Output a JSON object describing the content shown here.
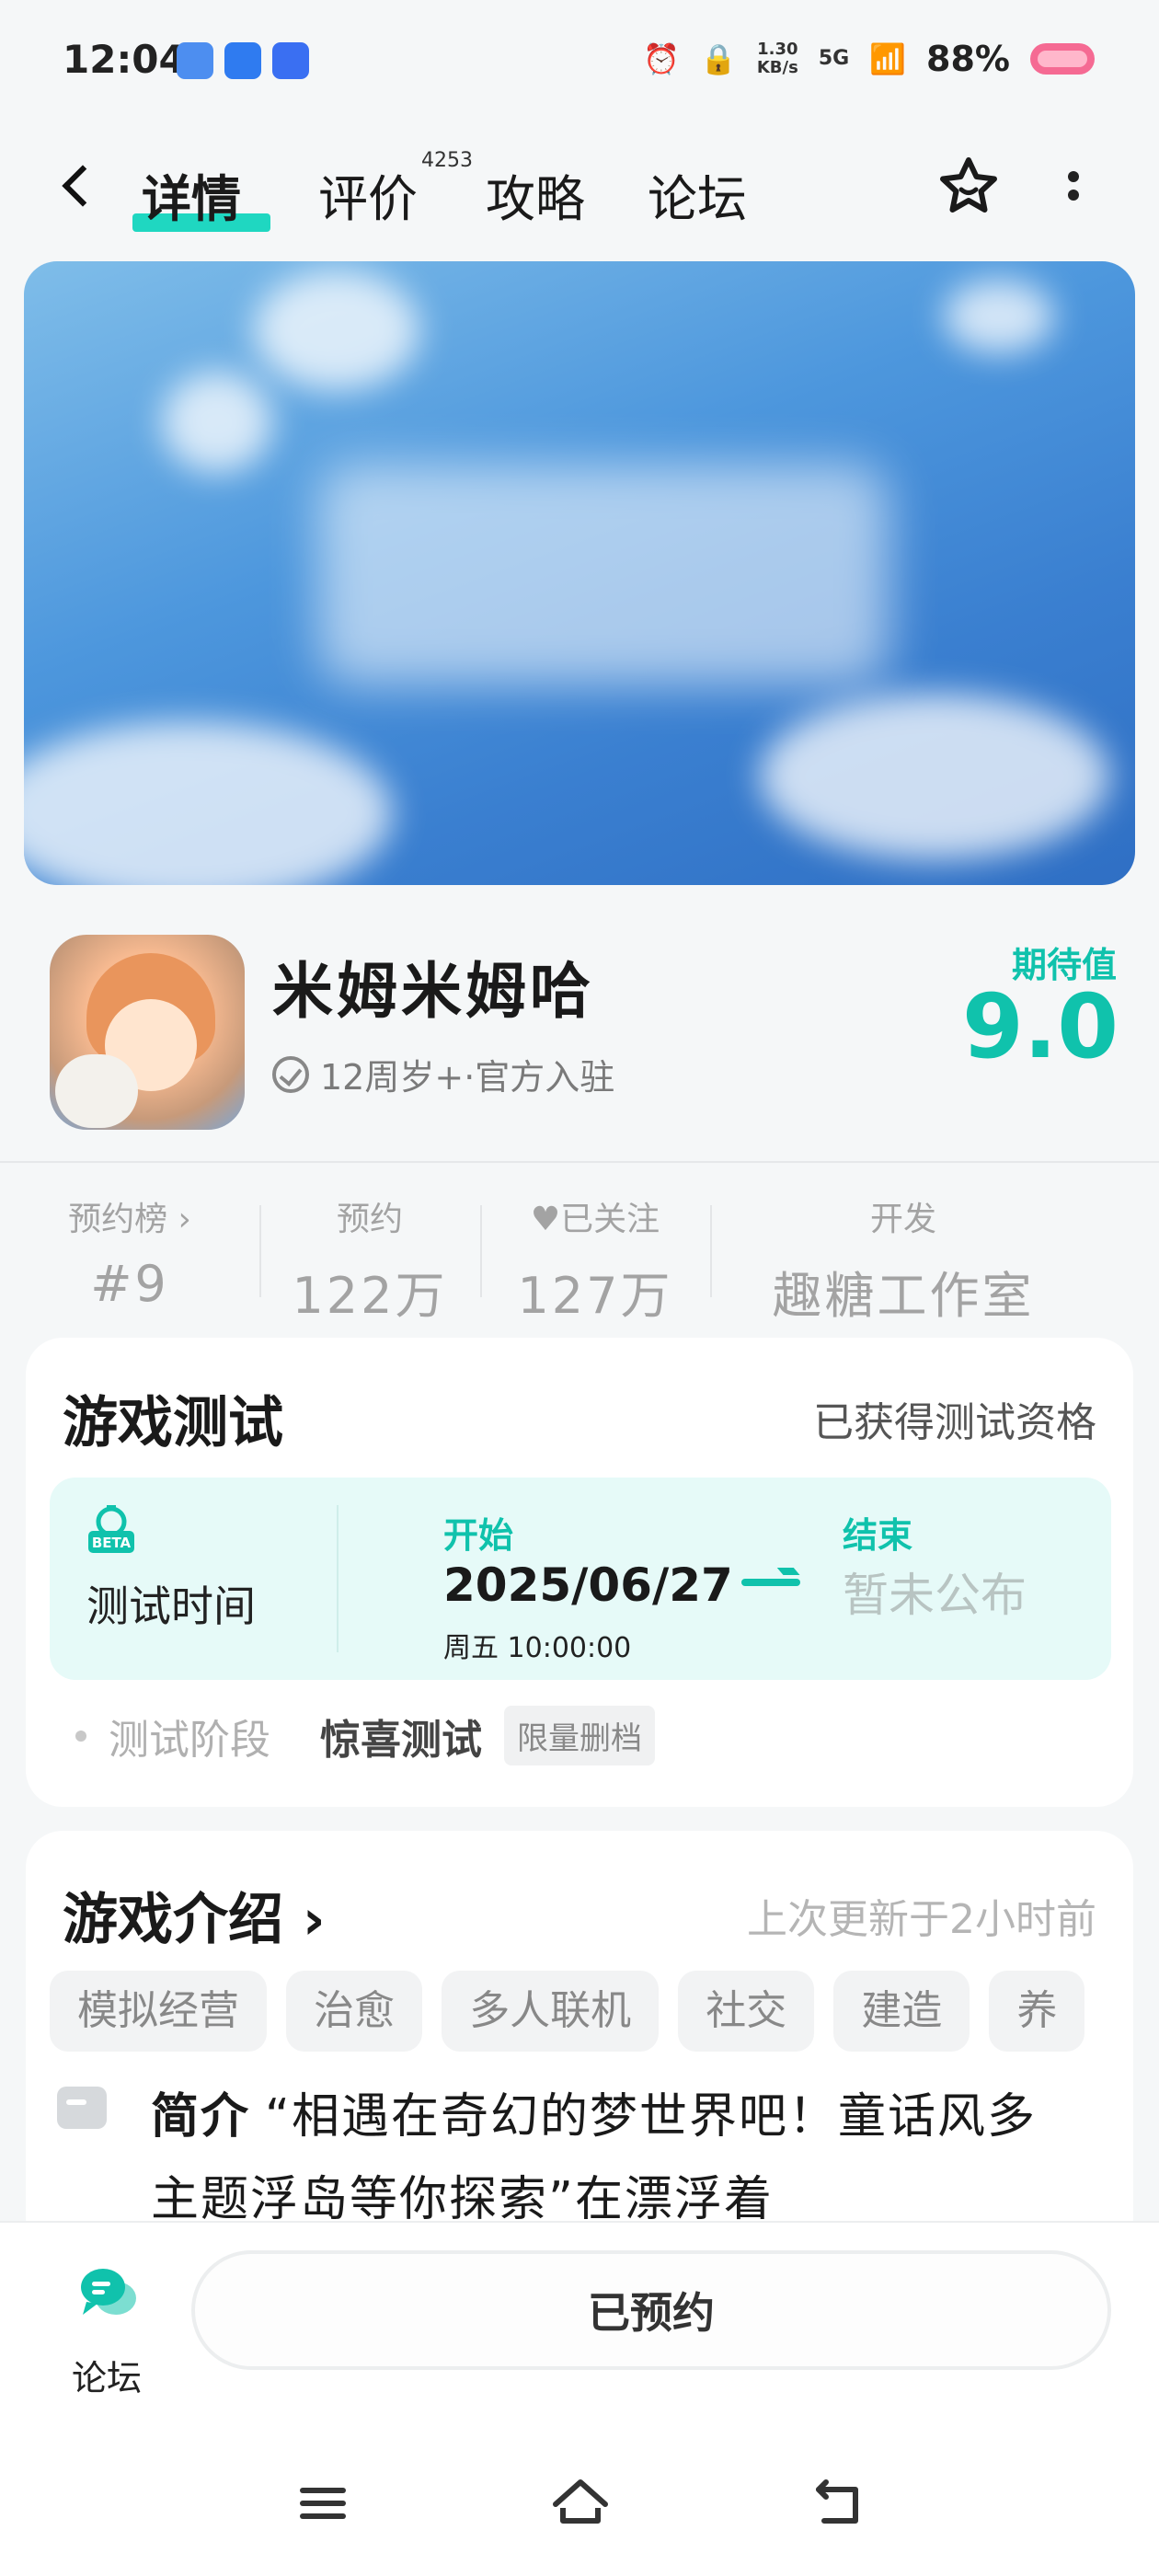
{
  "status_bar": {
    "time": "12:04",
    "speed_top": "1.30",
    "speed_unit": "KB/s",
    "network": "5G",
    "battery": "88%",
    "colors": {
      "battery": "#f56a93"
    }
  },
  "nav": {
    "tabs": [
      {
        "label": "详情",
        "active": true
      },
      {
        "label": "评价",
        "active": false
      },
      {
        "label": "攻略",
        "active": false
      },
      {
        "label": "论坛",
        "active": false
      }
    ],
    "review_count": "4253",
    "icons": [
      "back-icon",
      "star-icon",
      "more-icon"
    ],
    "accent": "#1fd7c1"
  },
  "game": {
    "name": "米姆米姆哈",
    "meta": "12周岁+·官方入驻",
    "expect_label": "期待值",
    "expect_score": "9.0",
    "accent": "#10c2ac"
  },
  "stats": [
    {
      "label": "预约榜 ›",
      "value": "#9"
    },
    {
      "label": "预约",
      "value": "122万"
    },
    {
      "label": "♥已关注",
      "value": "127万"
    },
    {
      "label": "开发",
      "value": "趣糖工作室"
    }
  ],
  "test_card": {
    "title": "游戏测试",
    "status": "已获得测试资格",
    "beta_badge": "BETA",
    "time_label": "测试时间",
    "start_label": "开始",
    "start_date": "2025/06/27",
    "start_time": "周五  10:00:00",
    "end_label": "结束",
    "end_value": "暂未公布",
    "stage_label": "测试阶段",
    "stage_value": "惊喜测试",
    "stage_tag": "限量删档"
  },
  "intro_card": {
    "title": "游戏介绍 ›",
    "updated": "上次更新于2小时前",
    "tags": [
      "模拟经营",
      "治愈",
      "多人联机",
      "社交",
      "建造",
      "养"
    ],
    "intro_prefix": "简介",
    "intro_text": "“相遇在奇幻的梦世界吧！童话风多主题浮岛等你探索”在漂浮着"
  },
  "bottom": {
    "forum_label": "论坛",
    "reserve_label": "已预约"
  }
}
